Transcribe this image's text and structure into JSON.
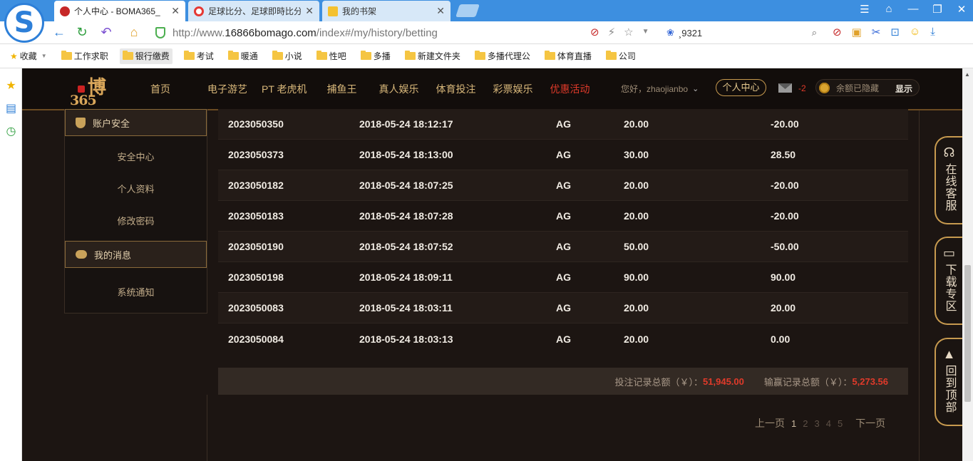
{
  "browser": {
    "tabs": [
      {
        "title": "个人中心 - BOMA365_",
        "active": true
      },
      {
        "title": "足球比分、足球即時比分",
        "active": false
      },
      {
        "title": "我的书架",
        "active": false
      }
    ],
    "url_prefix": "http://www.",
    "url_domain": "16866bomago.com",
    "url_path": "/index#/my/history/betting",
    "search_value": "¸9321",
    "bookmarks": [
      "收藏",
      "工作求职",
      "银行缴费",
      "考试",
      "暖通",
      "小说",
      "性吧",
      "多播",
      "新建文件夹",
      "多播代理公",
      "体育直播",
      "公司"
    ]
  },
  "site": {
    "logo_big": "博",
    "logo_num": "365",
    "menu": [
      "首页",
      "电子游艺",
      "PT 老虎机",
      "捕鱼王",
      "真人娱乐",
      "体育投注",
      "彩票娱乐",
      "优惠活动"
    ],
    "greeting": "您好，zhaojianbo",
    "personal_center": "个人中心",
    "mail_count": "-2",
    "balance_hidden": "余额已隐藏",
    "balance_show": "显示",
    "accent_red": "#e03a2a",
    "gold": "#c79a4f"
  },
  "sidebar": {
    "section1": "账户安全",
    "items1": [
      "安全中心",
      "个人资料",
      "修改密码"
    ],
    "section2": "我的消息",
    "items2": [
      "系统通知"
    ]
  },
  "table": {
    "rows": [
      {
        "id": "2023050350",
        "time": "2018-05-24 18:12:17",
        "platform": "AG",
        "bet": "20.00",
        "result": "-20.00"
      },
      {
        "id": "2023050373",
        "time": "2018-05-24 18:13:00",
        "platform": "AG",
        "bet": "30.00",
        "result": "28.50"
      },
      {
        "id": "2023050182",
        "time": "2018-05-24 18:07:25",
        "platform": "AG",
        "bet": "20.00",
        "result": "-20.00"
      },
      {
        "id": "2023050183",
        "time": "2018-05-24 18:07:28",
        "platform": "AG",
        "bet": "20.00",
        "result": "-20.00"
      },
      {
        "id": "2023050190",
        "time": "2018-05-24 18:07:52",
        "platform": "AG",
        "bet": "50.00",
        "result": "-50.00"
      },
      {
        "id": "2023050198",
        "time": "2018-05-24 18:09:11",
        "platform": "AG",
        "bet": "90.00",
        "result": "90.00"
      },
      {
        "id": "2023050083",
        "time": "2018-05-24 18:03:11",
        "platform": "AG",
        "bet": "20.00",
        "result": "20.00"
      },
      {
        "id": "2023050084",
        "time": "2018-05-24 18:03:13",
        "platform": "AG",
        "bet": "20.00",
        "result": "0.00"
      }
    ]
  },
  "totals": {
    "bet_label": "投注记录总额（￥）：",
    "bet_value": "51,945.00",
    "win_label": "输赢记录总额（￥）：",
    "win_value": "5,273.56"
  },
  "pager": {
    "prev": "上一页",
    "pages": [
      "1",
      "2",
      "3",
      "4",
      "5"
    ],
    "current": "1",
    "next": "下一页"
  },
  "float_buttons": [
    {
      "label": "在线客服",
      "icon": "headset-icon"
    },
    {
      "label": "下载专区",
      "icon": "monitor-icon"
    },
    {
      "label": "回到顶部",
      "icon": "rocket-icon"
    }
  ]
}
